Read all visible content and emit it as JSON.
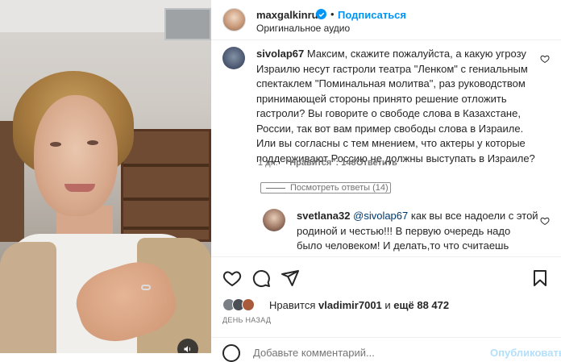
{
  "header": {
    "username": "maxgalkinru",
    "follow_label": "Подписаться",
    "separator": "•",
    "audio_label": "Оригинальное аудио"
  },
  "comments": [
    {
      "username": "sivolap67",
      "text": "Максим, скажите пожалуйста, а какую угрозу Израилю несут гастроли театра \"Ленком\" с гениальным спектаклем \"Поминальная молитва\", раз руководством принимающей стороны принято решение отложить гастроли? Вы говорите о свободе слова в Казахстане, России, так вот вам пример свободы слова в Израиле. Или вы согласны с тем мнением, что актеры у которые поддерживают Россию не должны выступать в Израиле?",
      "time": "1 дн.",
      "likes": "\"Нравится\": 148",
      "reply_label": "Ответить",
      "view_replies": "Посмотреть ответы (14)"
    },
    {
      "username": "svetlana32",
      "mention": "@sivolap67",
      "text": " как вы все надоели с этой родиной и честью!!! В первую очередь надо было человеком! И делать,то что считаешь нужным! человеку дана одна жизнь и он имеет право"
    }
  ],
  "likes": {
    "prefix": "Нравится",
    "user": "vladimir7001",
    "conj": "и",
    "more": "ещё 88 472"
  },
  "timeago": "ДЕНЬ НАЗАД",
  "comment_input": {
    "placeholder": "Добавьте комментарий...",
    "publish_label": "Опубликовать"
  },
  "colors": {
    "accent": "#0095f6",
    "text": "#262626",
    "secondary": "#737373"
  }
}
